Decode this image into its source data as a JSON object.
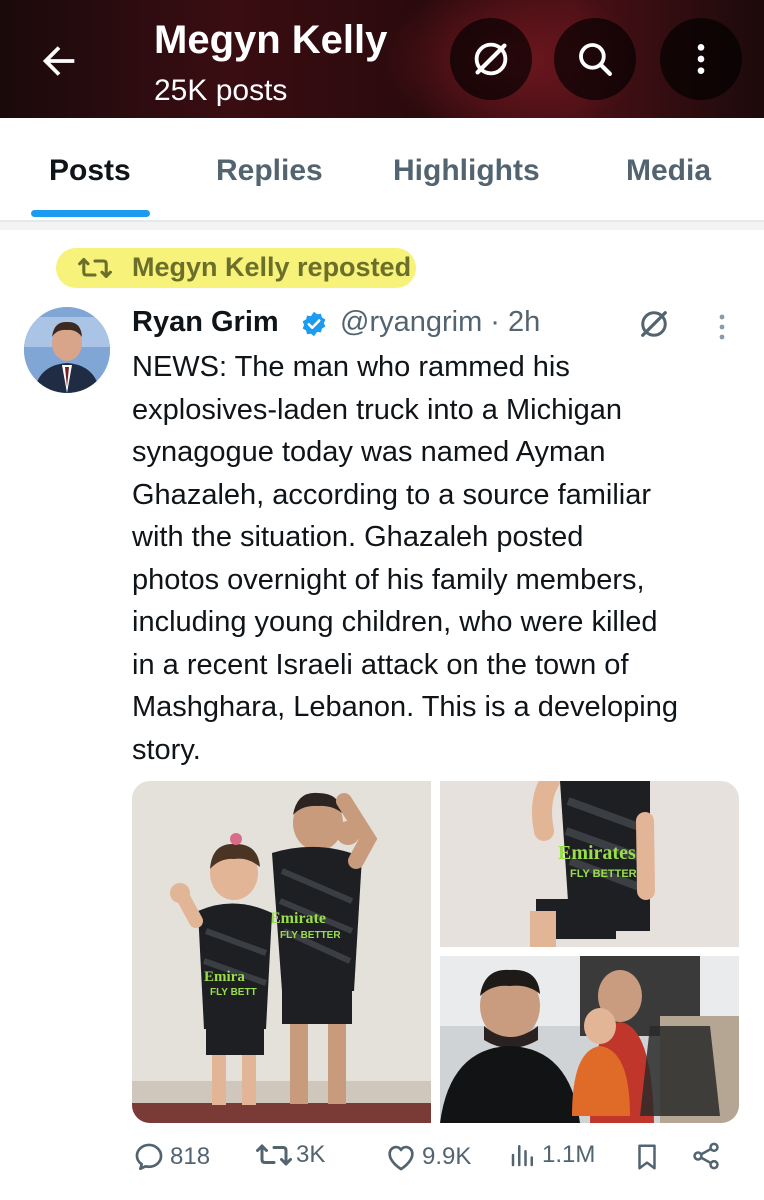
{
  "header": {
    "back_icon": "arrow-left-icon",
    "title": "Megyn Kelly",
    "subtitle": "25K posts",
    "icons": [
      "grok-icon",
      "search-icon",
      "more-vertical-icon"
    ]
  },
  "tabs": [
    "Posts",
    "Replies",
    "Highlights",
    "Media"
  ],
  "active_tab": "Posts",
  "repost_label": "Megyn Kelly reposted",
  "tweet": {
    "author_name": "Ryan Grim",
    "handle_time": "@ryangrim · 2h",
    "text": "NEWS: The man who rammed his\nexplosives-laden truck into a Michigan\nsynagogue today was named Ayman\nGhazaleh, according to a source familiar\nwith the situation. Ghazaleh posted\nphotos overnight of his family members,\nincluding young children, who were killed\nin a recent Israeli attack on the town of\nMashghara, Lebanon. This is a developing\nstory.",
    "photo_jersey_text": [
      "Emirate",
      "FLY BETTER",
      "Emira",
      "FLY BETT",
      "Emirates",
      "FLY BETTER"
    ],
    "stats": {
      "replies": "818",
      "reposts": "3K",
      "likes": "9.9K",
      "views": "1.1M"
    }
  },
  "colors": {
    "accent": "#1d9bf0",
    "highlight": "#f6f27a",
    "secondary_text": "#536471"
  }
}
